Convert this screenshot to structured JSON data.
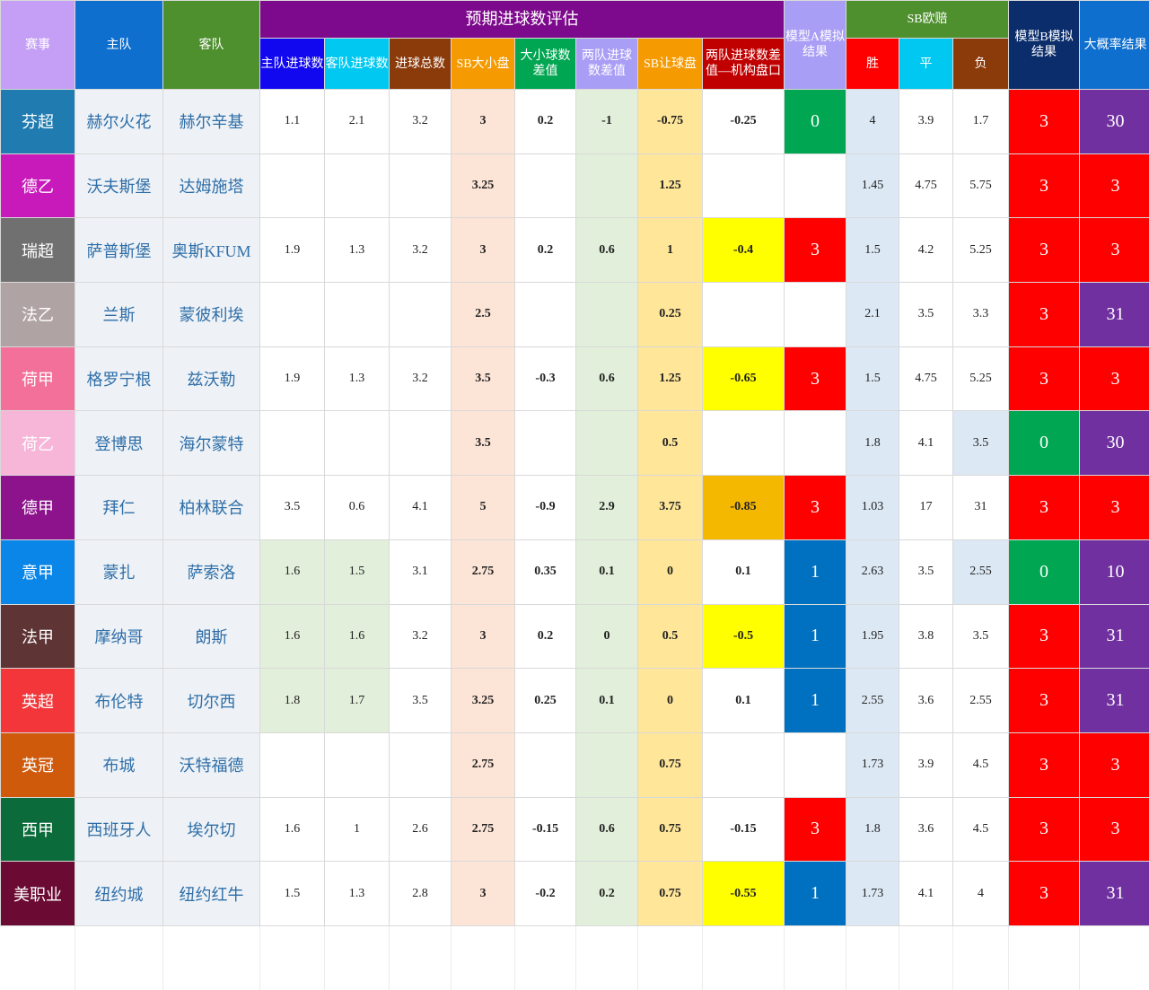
{
  "headers": {
    "league": "赛事",
    "home": "主队",
    "away": "客队",
    "expected_group": "预期进球数评估",
    "home_goals": "主队进球数",
    "away_goals": "客队进球数",
    "total_goals": "进球总数",
    "sb_ou": "SB大小盘",
    "ou_diff": "大小球数差值",
    "team_diff": "两队进球数差值",
    "sb_handicap": "SB让球盘",
    "inst_diff": "两队进球数差值—机构盘口",
    "model_a": "模型A模拟结果",
    "sb_euro": "SB欧赔",
    "win": "胜",
    "draw": "平",
    "loss": "负",
    "model_b": "模型B模拟结果",
    "prob": "大概率结果"
  },
  "colors": {
    "header_purple": "#7d0a8c",
    "red": "#ff0000",
    "green": "#00a651",
    "blue": "#0070c0",
    "purple_cell": "#7030a0",
    "yellow": "#ffff00",
    "orange": "#f5b800"
  },
  "rows": [
    {
      "league": "芬超",
      "lc": "#1f7bb0",
      "home": "赫尔火花",
      "away": "赫尔辛基",
      "hg": "1.1",
      "ag": "2.1",
      "tg": "3.2",
      "ou": "3",
      "oud": "0.2",
      "td": "-1",
      "hc": "-0.75",
      "id": "-0.25",
      "idbg": "#ffffff",
      "ma": "0",
      "mabg": "#00a651",
      "w": "4",
      "d": "3.9",
      "l": "1.7",
      "lbg": "#ffffff",
      "mb": "3",
      "mbbg": "#ff0000",
      "p": "30",
      "pbg": "#7030a0",
      "hgbg": "#ffffff"
    },
    {
      "league": "德乙",
      "lc": "#c81aba",
      "home": "沃夫斯堡",
      "away": "达姆施塔",
      "hg": "",
      "ag": "",
      "tg": "",
      "ou": "3.25",
      "oud": "",
      "td": "",
      "hc": "1.25",
      "id": "",
      "idbg": "#ffffff",
      "ma": "",
      "mabg": "#ffffff",
      "w": "1.45",
      "d": "4.75",
      "l": "5.75",
      "lbg": "#ffffff",
      "mb": "3",
      "mbbg": "#ff0000",
      "p": "3",
      "pbg": "#ff0000",
      "hgbg": "#ffffff"
    },
    {
      "league": "瑞超",
      "lc": "#707070",
      "home": "萨普斯堡",
      "away": "奥斯KFUM",
      "hg": "1.9",
      "ag": "1.3",
      "tg": "3.2",
      "ou": "3",
      "oud": "0.2",
      "td": "0.6",
      "hc": "1",
      "id": "-0.4",
      "idbg": "#ffff00",
      "ma": "3",
      "mabg": "#ff0000",
      "w": "1.5",
      "d": "4.2",
      "l": "5.25",
      "lbg": "#ffffff",
      "mb": "3",
      "mbbg": "#ff0000",
      "p": "3",
      "pbg": "#ff0000",
      "hgbg": "#ffffff"
    },
    {
      "league": "法乙",
      "lc": "#b0a3a3",
      "home": "兰斯",
      "away": "蒙彼利埃",
      "hg": "",
      "ag": "",
      "tg": "",
      "ou": "2.5",
      "oud": "",
      "td": "",
      "hc": "0.25",
      "id": "",
      "idbg": "#ffffff",
      "ma": "",
      "mabg": "#ffffff",
      "w": "2.1",
      "d": "3.5",
      "l": "3.3",
      "lbg": "#ffffff",
      "mb": "3",
      "mbbg": "#ff0000",
      "p": "31",
      "pbg": "#7030a0",
      "hgbg": "#ffffff"
    },
    {
      "league": "荷甲",
      "lc": "#f2709a",
      "home": "格罗宁根",
      "away": "兹沃勒",
      "hg": "1.9",
      "ag": "1.3",
      "tg": "3.2",
      "ou": "3.5",
      "oud": "-0.3",
      "td": "0.6",
      "hc": "1.25",
      "id": "-0.65",
      "idbg": "#ffff00",
      "ma": "3",
      "mabg": "#ff0000",
      "w": "1.5",
      "d": "4.75",
      "l": "5.25",
      "lbg": "#ffffff",
      "mb": "3",
      "mbbg": "#ff0000",
      "p": "3",
      "pbg": "#ff0000",
      "hgbg": "#ffffff"
    },
    {
      "league": "荷乙",
      "lc": "#f7b5d8",
      "home": "登博思",
      "away": "海尔蒙特",
      "hg": "",
      "ag": "",
      "tg": "",
      "ou": "3.5",
      "oud": "",
      "td": "",
      "hc": "0.5",
      "id": "",
      "idbg": "#ffffff",
      "ma": "",
      "mabg": "#ffffff",
      "w": "1.8",
      "d": "4.1",
      "l": "3.5",
      "lbg": "#dce9f5",
      "mb": "0",
      "mbbg": "#00a651",
      "p": "30",
      "pbg": "#7030a0",
      "hgbg": "#ffffff"
    },
    {
      "league": "德甲",
      "lc": "#8c138c",
      "home": "拜仁",
      "away": "柏林联合",
      "hg": "3.5",
      "ag": "0.6",
      "tg": "4.1",
      "ou": "5",
      "oud": "-0.9",
      "td": "2.9",
      "hc": "3.75",
      "id": "-0.85",
      "idbg": "#f5b800",
      "ma": "3",
      "mabg": "#ff0000",
      "w": "1.03",
      "d": "17",
      "l": "31",
      "lbg": "#ffffff",
      "mb": "3",
      "mbbg": "#ff0000",
      "p": "3",
      "pbg": "#ff0000",
      "hgbg": "#ffffff"
    },
    {
      "league": "意甲",
      "lc": "#0a86e8",
      "home": "蒙扎",
      "away": "萨索洛",
      "hg": "1.6",
      "ag": "1.5",
      "tg": "3.1",
      "ou": "2.75",
      "oud": "0.35",
      "td": "0.1",
      "hc": "0",
      "id": "0.1",
      "idbg": "#ffffff",
      "ma": "1",
      "mabg": "#0070c0",
      "w": "2.63",
      "d": "3.5",
      "l": "2.55",
      "lbg": "#dce9f5",
      "mb": "0",
      "mbbg": "#00a651",
      "p": "10",
      "pbg": "#7030a0",
      "hgbg": "#e2efda"
    },
    {
      "league": "法甲",
      "lc": "#5e3434",
      "home": "摩纳哥",
      "away": "朗斯",
      "hg": "1.6",
      "ag": "1.6",
      "tg": "3.2",
      "ou": "3",
      "oud": "0.2",
      "td": "0",
      "hc": "0.5",
      "id": "-0.5",
      "idbg": "#ffff00",
      "ma": "1",
      "mabg": "#0070c0",
      "w": "1.95",
      "d": "3.8",
      "l": "3.5",
      "lbg": "#ffffff",
      "mb": "3",
      "mbbg": "#ff0000",
      "p": "31",
      "pbg": "#7030a0",
      "hgbg": "#e2efda"
    },
    {
      "league": "英超",
      "lc": "#f2363a",
      "home": "布伦特",
      "away": "切尔西",
      "hg": "1.8",
      "ag": "1.7",
      "tg": "3.5",
      "ou": "3.25",
      "oud": "0.25",
      "td": "0.1",
      "hc": "0",
      "id": "0.1",
      "idbg": "#ffffff",
      "ma": "1",
      "mabg": "#0070c0",
      "w": "2.55",
      "d": "3.6",
      "l": "2.55",
      "lbg": "#ffffff",
      "mb": "3",
      "mbbg": "#ff0000",
      "p": "31",
      "pbg": "#7030a0",
      "hgbg": "#e2efda"
    },
    {
      "league": "英冠",
      "lc": "#cf5a0c",
      "home": "布城",
      "away": "沃特福德",
      "hg": "",
      "ag": "",
      "tg": "",
      "ou": "2.75",
      "oud": "",
      "td": "",
      "hc": "0.75",
      "id": "",
      "idbg": "#ffffff",
      "ma": "",
      "mabg": "#ffffff",
      "w": "1.73",
      "d": "3.9",
      "l": "4.5",
      "lbg": "#ffffff",
      "mb": "3",
      "mbbg": "#ff0000",
      "p": "3",
      "pbg": "#ff0000",
      "hgbg": "#ffffff"
    },
    {
      "league": "西甲",
      "lc": "#0c6b3a",
      "home": "西班牙人",
      "away": "埃尔切",
      "hg": "1.6",
      "ag": "1",
      "tg": "2.6",
      "ou": "2.75",
      "oud": "-0.15",
      "td": "0.6",
      "hc": "0.75",
      "id": "-0.15",
      "idbg": "#ffffff",
      "ma": "3",
      "mabg": "#ff0000",
      "w": "1.8",
      "d": "3.6",
      "l": "4.5",
      "lbg": "#ffffff",
      "mb": "3",
      "mbbg": "#ff0000",
      "p": "3",
      "pbg": "#ff0000",
      "hgbg": "#ffffff"
    },
    {
      "league": "美职业",
      "lc": "#6b0a33",
      "home": "纽约城",
      "away": "纽约红牛",
      "hg": "1.5",
      "ag": "1.3",
      "tg": "2.8",
      "ou": "3",
      "oud": "-0.2",
      "td": "0.2",
      "hc": "0.75",
      "id": "-0.55",
      "idbg": "#ffff00",
      "ma": "1",
      "mabg": "#0070c0",
      "w": "1.73",
      "d": "4.1",
      "l": "4",
      "lbg": "#ffffff",
      "mb": "3",
      "mbbg": "#ff0000",
      "p": "31",
      "pbg": "#7030a0",
      "hgbg": "#ffffff"
    }
  ]
}
